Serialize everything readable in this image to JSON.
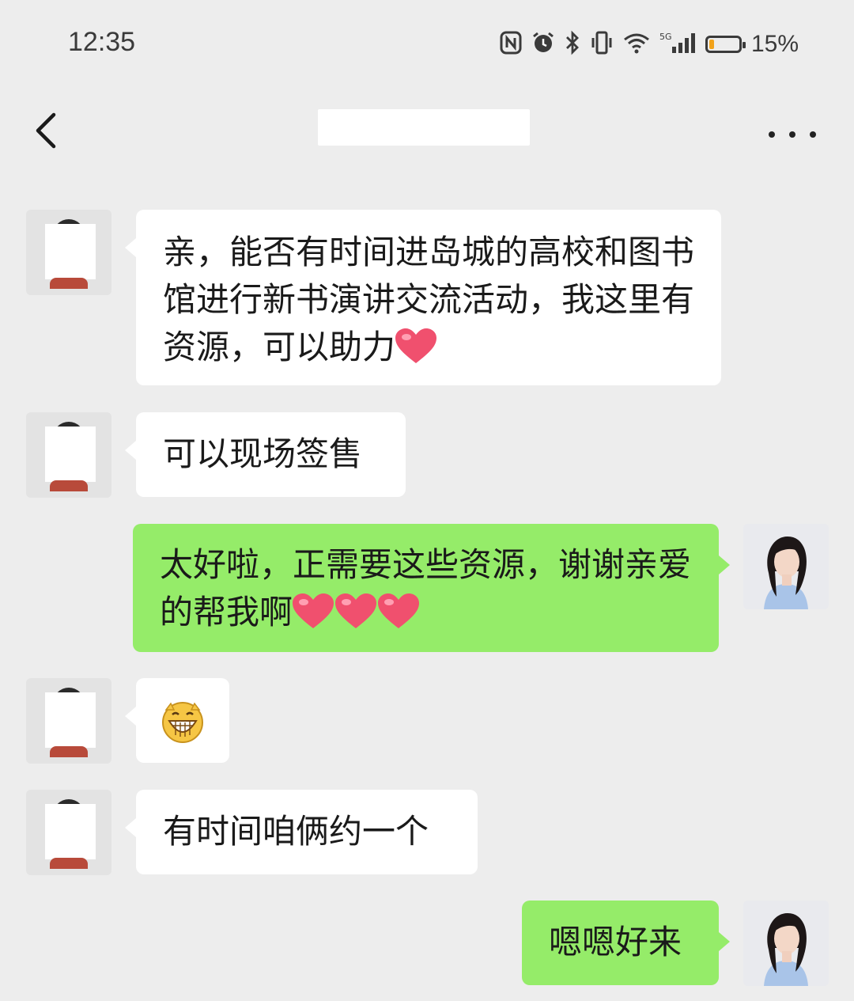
{
  "status_bar": {
    "time": "12:35",
    "network": "5G",
    "battery_percent": "15%",
    "battery_level": 0.15
  },
  "nav": {
    "title": ""
  },
  "messages": [
    {
      "side": "left",
      "parts": [
        "亲，能否有时间进岛城的高校和图书馆进行新书演讲交流活动，我这里有资源，可以助力"
      ],
      "emoji": "heart"
    },
    {
      "side": "left",
      "parts": [
        "可以现场签售"
      ]
    },
    {
      "side": "right",
      "parts": [
        "太好啦，正需要这些资源，谢谢亲爱的帮我啊"
      ],
      "emoji": "heart x3"
    },
    {
      "side": "left",
      "parts": [],
      "emoji": "grin"
    },
    {
      "side": "left",
      "parts": [
        "有时间咱俩约一个"
      ]
    },
    {
      "side": "right",
      "parts": [
        "嗯嗯好来"
      ]
    }
  ],
  "colors": {
    "background": "#ededed",
    "bubble_self": "#95ec69",
    "bubble_other": "#ffffff",
    "heart": "#f0506e",
    "battery_fill": "#f2a31b"
  }
}
